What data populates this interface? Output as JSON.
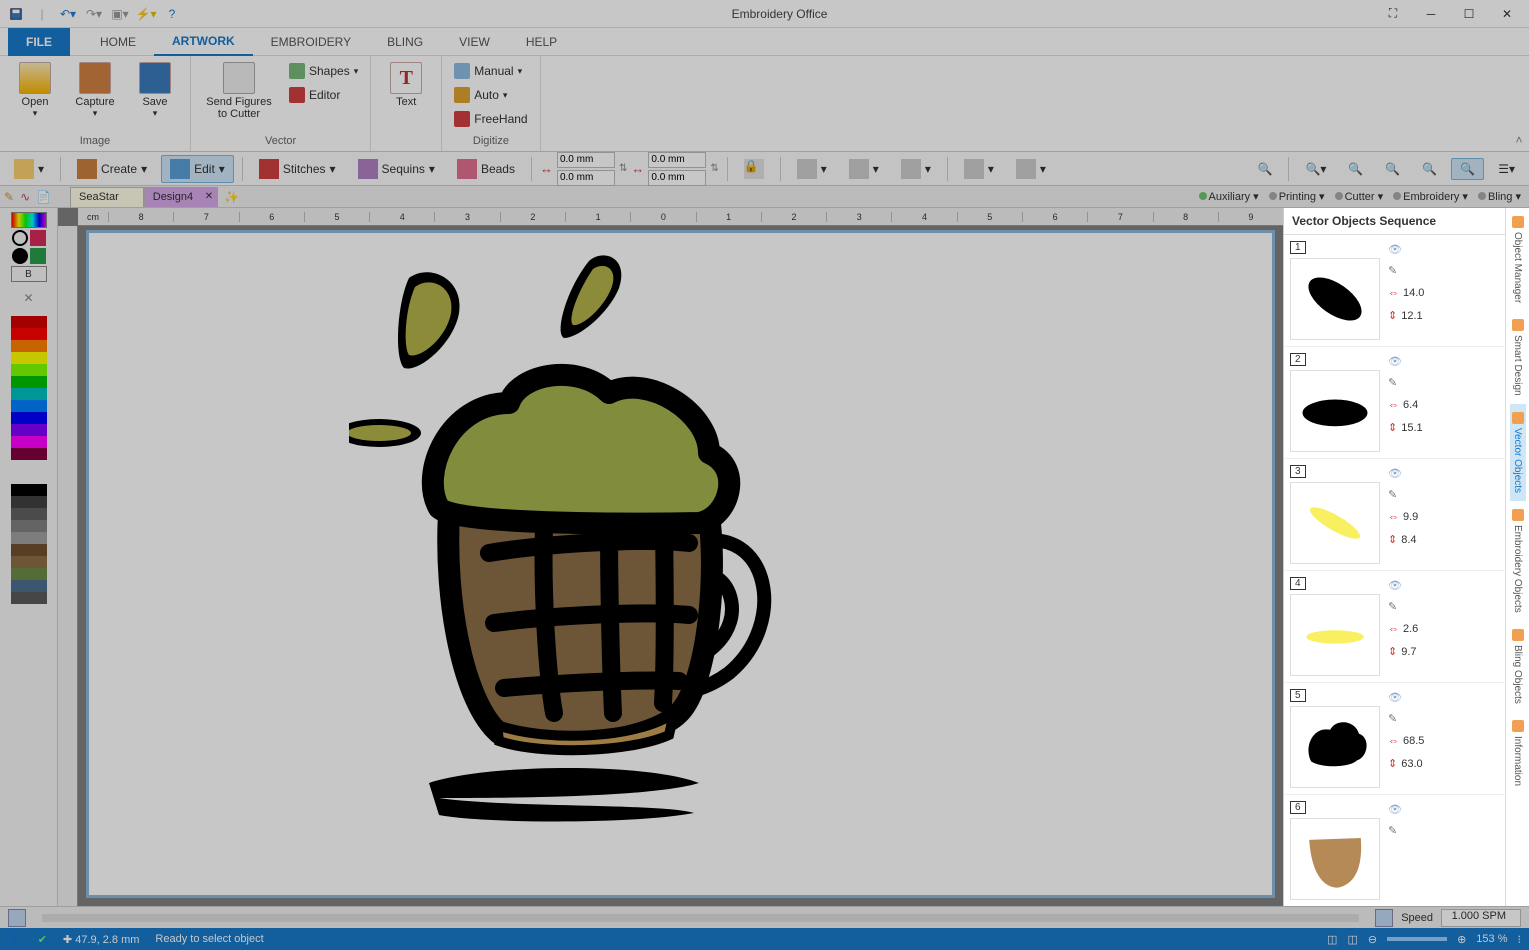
{
  "app": {
    "title": "Embroidery Office"
  },
  "quick_access": [
    "save",
    "undo",
    "redo",
    "open",
    "macro",
    "help"
  ],
  "menu_tabs": {
    "file": "FILE",
    "items": [
      "HOME",
      "ARTWORK",
      "EMBROIDERY",
      "BLING",
      "VIEW",
      "HELP"
    ],
    "active": "ARTWORK"
  },
  "ribbon": {
    "image": {
      "label": "Image",
      "open": "Open",
      "capture": "Capture",
      "save": "Save"
    },
    "vector": {
      "label": "Vector",
      "send": "Send Figures\nto Cutter",
      "shapes": "Shapes",
      "editor": "Editor"
    },
    "text": {
      "label": "",
      "text": "Text"
    },
    "digitize": {
      "label": "Digitize",
      "manual": "Manual",
      "auto": "Auto",
      "freehand": "FreeHand"
    }
  },
  "toolbar2": {
    "create": "Create",
    "edit": "Edit",
    "stitches": "Stitches",
    "sequins": "Sequins",
    "beads": "Beads",
    "dims": {
      "w1": "0.0 mm",
      "h1": "0.0 mm",
      "w2": "0.0 mm",
      "h2": "0.0 mm"
    }
  },
  "doc_tabs": {
    "items": [
      {
        "label": "SeaStar",
        "active": false
      },
      {
        "label": "Design4",
        "active": true
      }
    ]
  },
  "output_modes": {
    "auxiliary": "Auxiliary",
    "printing": "Printing",
    "cutter": "Cutter",
    "embroidery": "Embroidery",
    "bling": "Bling"
  },
  "ruler_unit": "cm",
  "palette_left_a": [
    "#d40000",
    "#ff0000",
    "#ff8000",
    "#ffff00",
    "#80ff00",
    "#00c000",
    "#00c0c0",
    "#0080ff",
    "#0000ff",
    "#8000ff",
    "#ff00ff",
    "#800040"
  ],
  "palette_left_b": [
    "#000000",
    "#404040",
    "#606060",
    "#808080",
    "#a0a0a0",
    "#705030",
    "#8b6f47",
    "#6f8b47",
    "#4f6f8f",
    "#5a5a5a"
  ],
  "right_panel": {
    "title": "Vector Objects Sequence",
    "items": [
      {
        "n": "1",
        "w": "14.0",
        "h": "12.1",
        "fill": "#000000",
        "shape": "blob-diag"
      },
      {
        "n": "2",
        "w": "6.4",
        "h": "15.1",
        "fill": "#000000",
        "shape": "blob-flat"
      },
      {
        "n": "3",
        "w": "9.9",
        "h": "8.4",
        "fill": "#f8f060",
        "shape": "streak-diag"
      },
      {
        "n": "4",
        "w": "2.6",
        "h": "9.7",
        "fill": "#f8f060",
        "shape": "streak-flat"
      },
      {
        "n": "5",
        "w": "68.5",
        "h": "63.0",
        "fill": "#000000",
        "shape": "foam"
      },
      {
        "n": "6",
        "w": "",
        "h": "",
        "fill": "#b58a56",
        "shape": "body"
      }
    ],
    "side_tabs": [
      "Object Manager",
      "Smart Design",
      "Vector Objects",
      "Embroidery Objects",
      "Bling Objects",
      "Information"
    ],
    "side_active": "Vector Objects"
  },
  "speed": {
    "label": "Speed",
    "value": "1.000 SPM"
  },
  "status": {
    "coords": "47.9, 2.8 mm",
    "msg": "Ready to select object",
    "zoom": "153 %"
  }
}
